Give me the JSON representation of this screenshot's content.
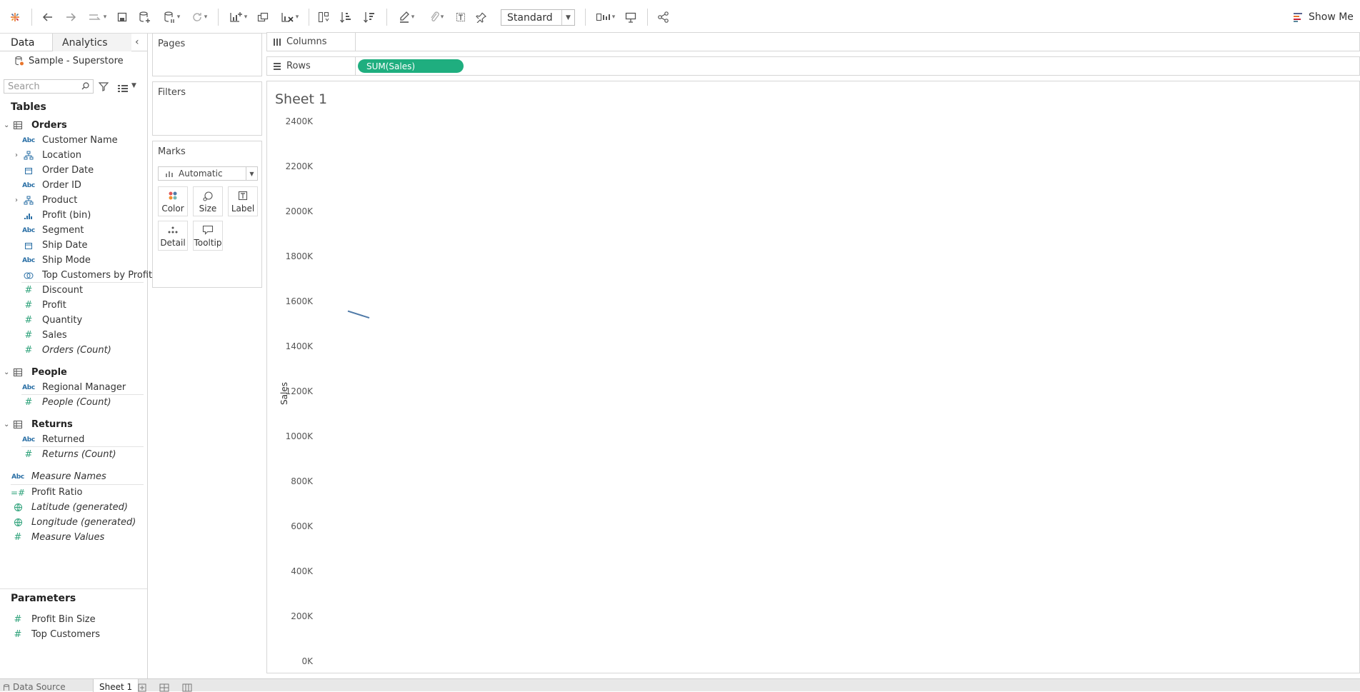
{
  "toolbar": {
    "mode_select": "Standard",
    "show_me": "Show Me",
    "icons": [
      "tableau-logo-icon",
      "undo-icon",
      "redo-icon",
      "replay-icon",
      "save-icon",
      "new-datasource-icon",
      "pause-updates-icon",
      "refresh-icon",
      "new-worksheet-icon",
      "duplicate-sheet-icon",
      "clear-sheet-icon",
      "swap-rows-columns-icon",
      "sort-ascending-icon",
      "sort-descending-icon",
      "highlight-icon",
      "group-icon",
      "label-marks-icon",
      "pin-icon",
      "fit-icon",
      "presentation-mode-icon",
      "share-icon"
    ]
  },
  "data_pane": {
    "tab_data": "Data",
    "tab_analytics": "Analytics",
    "datasource": "Sample - Superstore",
    "search_placeholder": "Search",
    "tables_heading": "Tables",
    "tables": [
      {
        "name": "Orders",
        "dimensions": [
          {
            "label": "Customer Name",
            "type": "abc"
          },
          {
            "label": "Location",
            "type": "hierarchy",
            "expandable": true
          },
          {
            "label": "Order Date",
            "type": "date"
          },
          {
            "label": "Order ID",
            "type": "abc"
          },
          {
            "label": "Product",
            "type": "hierarchy",
            "expandable": true
          },
          {
            "label": "Profit (bin)",
            "type": "bin"
          },
          {
            "label": "Segment",
            "type": "abc"
          },
          {
            "label": "Ship Date",
            "type": "date"
          },
          {
            "label": "Ship Mode",
            "type": "abc"
          },
          {
            "label": "Top Customers by Profit",
            "type": "set"
          }
        ],
        "measures": [
          {
            "label": "Discount"
          },
          {
            "label": "Profit"
          },
          {
            "label": "Quantity"
          },
          {
            "label": "Sales"
          },
          {
            "label": "Orders (Count)",
            "italic": true
          }
        ]
      },
      {
        "name": "People",
        "dimensions": [
          {
            "label": "Regional Manager",
            "type": "abc"
          }
        ],
        "measures": [
          {
            "label": "People (Count)",
            "italic": true
          }
        ]
      },
      {
        "name": "Returns",
        "dimensions": [
          {
            "label": "Returned",
            "type": "abc"
          }
        ],
        "measures": [
          {
            "label": "Returns (Count)",
            "italic": true
          }
        ]
      }
    ],
    "extra_fields": [
      {
        "label": "Measure Names",
        "type": "abc",
        "italic": true
      },
      {
        "label": "Profit Ratio",
        "type": "calc"
      },
      {
        "label": "Latitude (generated)",
        "type": "geo",
        "italic": true
      },
      {
        "label": "Longitude (generated)",
        "type": "geo",
        "italic": true
      },
      {
        "label": "Measure Values",
        "type": "measure",
        "italic": true
      }
    ],
    "parameters_heading": "Parameters",
    "parameters": [
      "Profit Bin Size",
      "Top Customers"
    ]
  },
  "shelves": {
    "pages": "Pages",
    "filters": "Filters",
    "marks": "Marks",
    "marks_type": "Automatic",
    "mark_buttons": [
      "Color",
      "Size",
      "Label",
      "Detail",
      "Tooltip"
    ],
    "columns": "Columns",
    "rows": "Rows",
    "rows_pill": "SUM(Sales)"
  },
  "viz": {
    "sheet_title": "Sheet 1"
  },
  "chart_data": {
    "type": "line",
    "ylabel": "Sales",
    "ylim": [
      0,
      2400
    ],
    "y_ticks": [
      "2400K",
      "2200K",
      "2000K",
      "1800K",
      "1600K",
      "1400K",
      "1200K",
      "1000K",
      "800K",
      "600K",
      "400K",
      "200K",
      "0K"
    ],
    "series": [
      {
        "values": [
          1560,
          1530
        ]
      }
    ],
    "line_color": "#4e79a7"
  },
  "bottom_tabs": {
    "data_source": "Data Source",
    "sheet": "Sheet 1"
  }
}
